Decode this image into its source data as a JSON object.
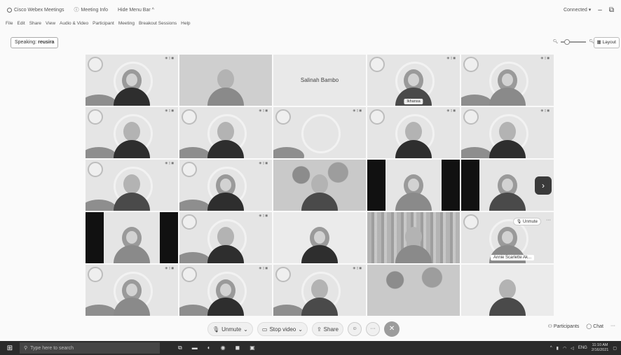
{
  "window": {
    "app_title": "Cisco Webex Meetings",
    "meeting_info": "Meeting Info",
    "hide_menu_bar": "Hide Menu Bar ^",
    "connection_status": "Connected",
    "minimize": "–",
    "restore": "⧉"
  },
  "menu": [
    "File",
    "Edit",
    "Share",
    "View",
    "Audio & Video",
    "Participant",
    "Meeting",
    "Breakout Sessions",
    "Help"
  ],
  "speaking": {
    "label": "Speaking:",
    "name": "reusira"
  },
  "layout_label": "Layout",
  "tiles": {
    "r0c2_name": "Salinah Bambo",
    "r0c3_name": "Ikhansa",
    "r3c4_unmute": "Unmute",
    "r3c4_name": "Annie Scarlette Ak..."
  },
  "next_page": "›",
  "toolbar": {
    "unmute": "Unmute",
    "stop_video": "Stop video",
    "share": "Share",
    "more": "···",
    "leave": "✕",
    "participants": "Participants",
    "chat": "Chat",
    "more_right": "···"
  },
  "taskbar": {
    "search_placeholder": "Type here to search",
    "lang": "ENG",
    "time": "11:10 AM",
    "date": "2/16/2021"
  }
}
